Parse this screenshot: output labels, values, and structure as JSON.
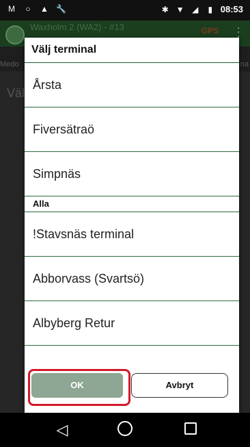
{
  "statusbar": {
    "icons_left": [
      "mail-icon",
      "circle-icon",
      "cloud-icon",
      "wrench-icon"
    ],
    "icons_right": [
      "bluetooth-icon",
      "wifi-icon",
      "signal-icon",
      "battery-icon"
    ],
    "time": "08:53"
  },
  "background_app": {
    "title": "Waxholm 2 (WA2) - #13",
    "gps_label": "GPS",
    "sub_left": "Medo",
    "sub_right": "na",
    "main_text": "Väl"
  },
  "dialog": {
    "title": "Välj terminal",
    "items_top": [
      "Årsta",
      "Fiversätraö",
      "Simpnäs"
    ],
    "section_label": "Alla",
    "items_all": [
      "!Stavsnäs terminal",
      "Abborvass (Svartsö)",
      "Albyberg Retur"
    ],
    "ok_label": "OK",
    "cancel_label": "Avbryt"
  },
  "colors": {
    "accent_green": "#2f6b3a",
    "ok_button": "#8ea694",
    "highlight_red": "#d11a2a"
  }
}
